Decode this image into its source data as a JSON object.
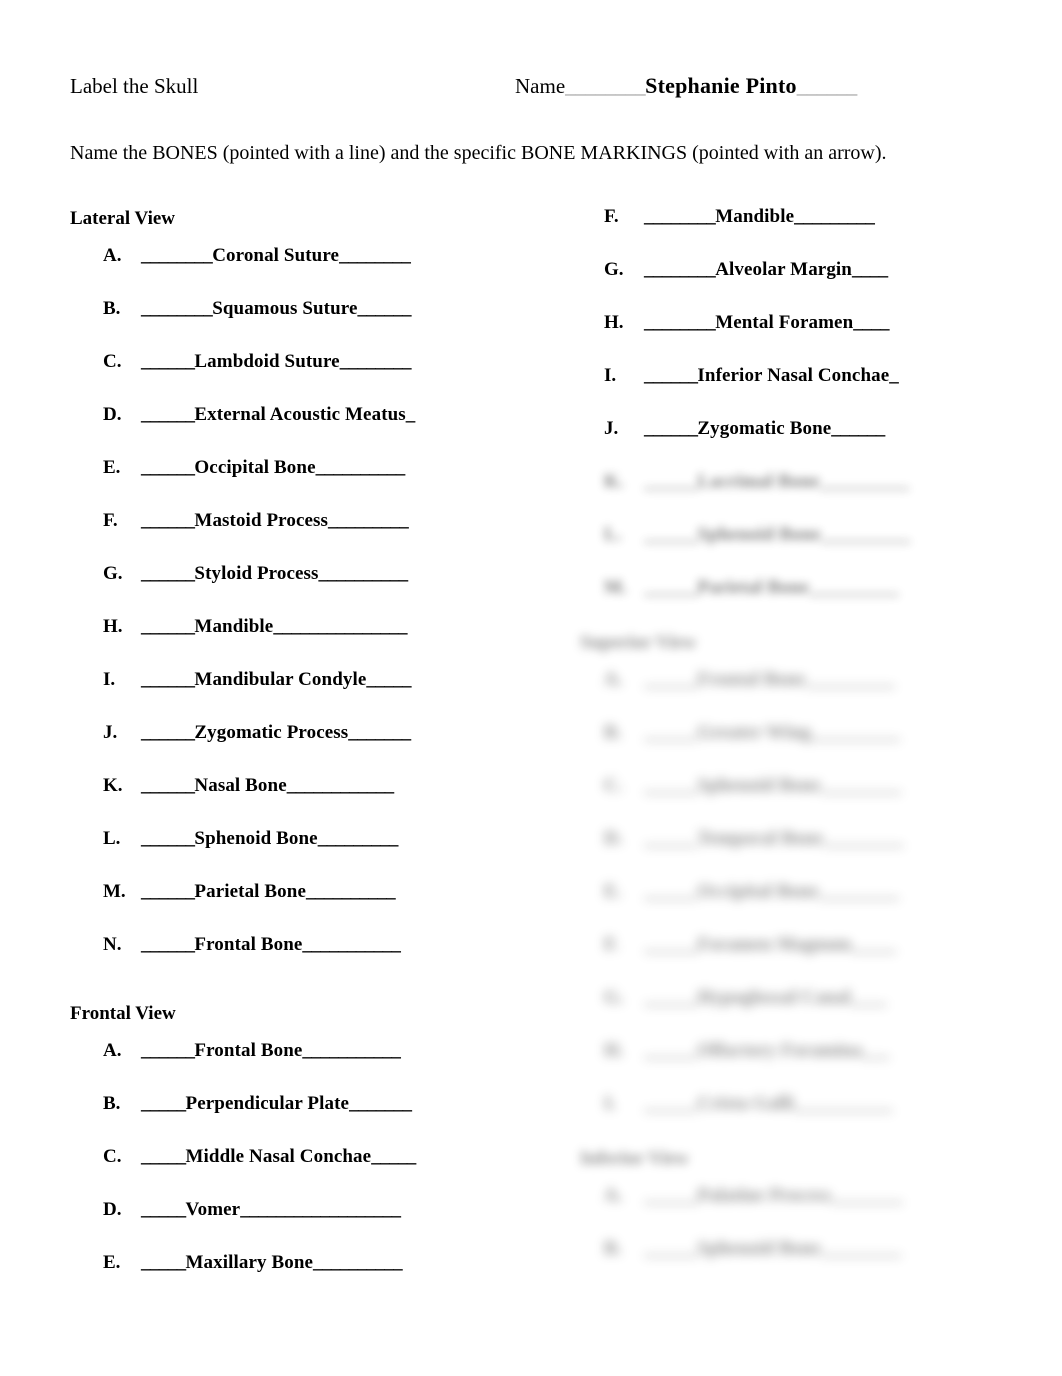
{
  "document": {
    "title": "Label the Skull",
    "instruction": "Name the BONES (pointed with a line) and the specific BONE MARKINGS (pointed with an arrow).",
    "name_field": {
      "label": "Name",
      "value": "Stephanie Pinto",
      "blank_before": "________",
      "blank_after": "______"
    }
  },
  "left_column": {
    "sections": [
      {
        "heading": "Lateral View",
        "items": [
          {
            "letter": "A.",
            "blank_before": "________",
            "answer": "Coronal Suture",
            "blank_after": "________"
          },
          {
            "letter": "B.",
            "blank_before": "________",
            "answer": "Squamous Suture",
            "blank_after": "______"
          },
          {
            "letter": "C.",
            "blank_before": "______",
            "answer": "Lambdoid Suture",
            "blank_after": "________"
          },
          {
            "letter": "D.",
            "blank_before": "______",
            "answer": "External Acoustic Meatus",
            "blank_after": "_"
          },
          {
            "letter": "E.",
            "blank_before": "______",
            "answer": "Occipital Bone",
            "blank_after": "__________"
          },
          {
            "letter": "F.",
            "blank_before": "______",
            "answer": "Mastoid Process",
            "blank_after": "_________"
          },
          {
            "letter": "G.",
            "blank_before": "______",
            "answer": "Styloid Process",
            "blank_after": "__________"
          },
          {
            "letter": "H.",
            "blank_before": "______",
            "answer": "Mandible",
            "blank_after": "_______________"
          },
          {
            "letter": "I.",
            "blank_before": "______",
            "answer": "Mandibular Condyle",
            "blank_after": "_____"
          },
          {
            "letter": "J.",
            "blank_before": "______",
            "answer": "Zygomatic Process",
            "blank_after": "_______"
          },
          {
            "letter": "K.",
            "blank_before": "______",
            "answer": "Nasal Bone",
            "blank_after": "____________"
          },
          {
            "letter": "L.",
            "blank_before": "______",
            "answer": "Sphenoid Bone",
            "blank_after": "_________"
          },
          {
            "letter": "M.",
            "blank_before": "______",
            "answer": "Parietal Bone",
            "blank_after": "__________"
          },
          {
            "letter": "N.",
            "blank_before": "______",
            "answer": "Frontal Bone",
            "blank_after": "___________"
          }
        ]
      },
      {
        "heading": "Frontal View",
        "items": [
          {
            "letter": "A.",
            "blank_before": "______",
            "answer": "Frontal Bone",
            "blank_after": "___________"
          },
          {
            "letter": "B.",
            "blank_before": "_____ ",
            "answer": "Perpendicular Plate",
            "blank_after": "_______"
          },
          {
            "letter": "C.",
            "blank_before": "_____",
            "answer": "Middle Nasal Conchae",
            "blank_after": "_____"
          },
          {
            "letter": "D.",
            "blank_before": "_____",
            "answer": "Vomer",
            "blank_after": "__________________"
          },
          {
            "letter": "E.",
            "blank_before": "_____",
            "answer": "Maxillary Bone",
            "blank_after": "__________"
          }
        ]
      }
    ]
  },
  "right_column": {
    "visible_items": [
      {
        "letter": "F.",
        "blank_before": "________",
        "answer": "Mandible",
        "blank_after": "_________"
      },
      {
        "letter": "G.",
        "blank_before": "________",
        "answer": "Alveolar Margin",
        "blank_after": " ____"
      },
      {
        "letter": "H.",
        "blank_before": "________",
        "answer": "Mental Foramen",
        "blank_after": "____"
      },
      {
        "letter": "I.",
        "blank_before": "______",
        "answer": "Inferior Nasal Conchae",
        "blank_after": "_"
      },
      {
        "letter": "J.",
        "blank_before": "______",
        "answer": "Zygomatic Bone",
        "blank_after": "______"
      }
    ],
    "redacted_note": "blurred-preview-region",
    "redacted_groups": [
      {
        "heading": null,
        "items": [
          {
            "letter": "K.",
            "blank_before": "______",
            "answer": "Lacrimal Bone",
            "blank_after": "__________"
          },
          {
            "letter": "L.",
            "blank_before": "______",
            "answer": "Sphenoid Bone",
            "blank_after": "__________"
          },
          {
            "letter": "M.",
            "blank_before": "______",
            "answer": "Parietal Bone",
            "blank_after": "__________"
          }
        ]
      },
      {
        "heading": "Superior View",
        "items": [
          {
            "letter": "A.",
            "blank_before": "______",
            "answer": "Frontal Bone",
            "blank_after": "__________"
          },
          {
            "letter": "B.",
            "blank_before": "______",
            "answer": "Greater Wing",
            "blank_after": "__________"
          },
          {
            "letter": "C.",
            "blank_before": "______",
            "answer": "Sphenoid Bone",
            "blank_after": "_________"
          },
          {
            "letter": "D.",
            "blank_before": "______",
            "answer": "Temporal Bone",
            "blank_after": "_________"
          },
          {
            "letter": "E.",
            "blank_before": "______",
            "answer": "Occipital Bone",
            "blank_after": "_________"
          },
          {
            "letter": "F.",
            "blank_before": "______",
            "answer": "Foramen Magnum",
            "blank_after": "_____"
          },
          {
            "letter": "G.",
            "blank_before": "______",
            "answer": "Hypoglossal Canal",
            "blank_after": "____"
          },
          {
            "letter": "H.",
            "blank_before": "______",
            "answer": "Olfactory Foramina",
            "blank_after": "___"
          },
          {
            "letter": "I.",
            "blank_before": "______",
            "answer": "Crista Galli",
            "blank_after": "___________"
          }
        ]
      },
      {
        "heading": "Inferior View",
        "items": [
          {
            "letter": "A.",
            "blank_before": "______",
            "answer": "Palatine Process",
            "blank_after": "________"
          },
          {
            "letter": "B.",
            "blank_before": "______",
            "answer": "Sphenoid Bone",
            "blank_after": "_________"
          }
        ]
      }
    ]
  }
}
